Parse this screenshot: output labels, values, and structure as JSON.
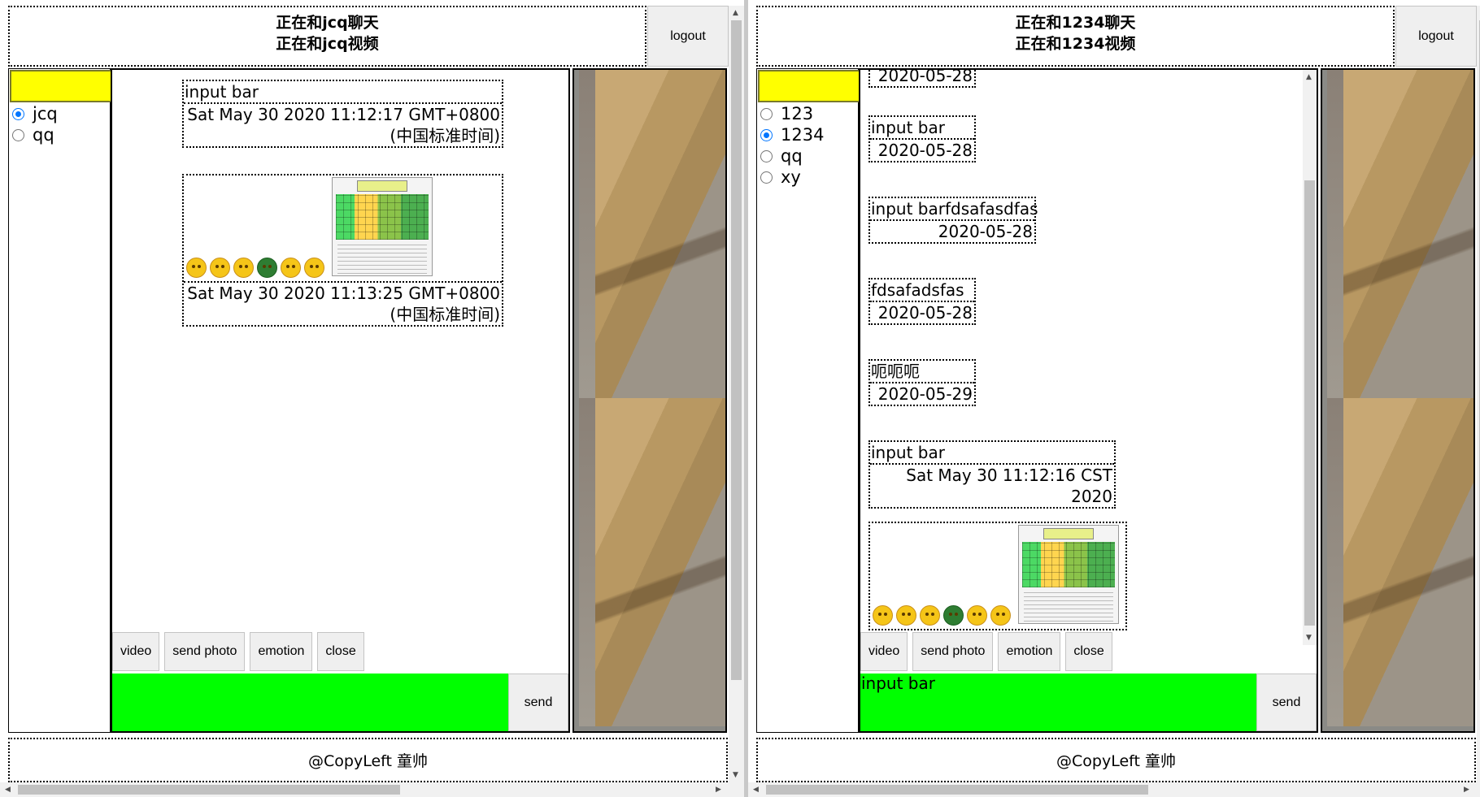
{
  "left": {
    "header": {
      "line1": "正在和jcq聊天",
      "line2": "正在和jcq视频"
    },
    "logout_label": "logout",
    "contacts": [
      {
        "label": "jcq",
        "checked": true
      },
      {
        "label": "qq",
        "checked": false
      }
    ],
    "messages": [
      {
        "text": "input bar",
        "time": "Sat May 30 2020 11:12:17 GMT+0800 (中国标准时间)"
      },
      {
        "text": "",
        "time": "Sat May 30 2020 11:13:25 GMT+0800 (中国标准时间)",
        "media": true
      }
    ],
    "toolbar": {
      "video": "video",
      "send_photo": "send photo",
      "emotion": "emotion",
      "close": "close"
    },
    "input_value": "",
    "send_label": "send",
    "footer": "@CopyLeft 童帅"
  },
  "right": {
    "header": {
      "line1": "正在和1234聊天",
      "line2": "正在和1234视频"
    },
    "logout_label": "logout",
    "contacts": [
      {
        "label": "123",
        "checked": false
      },
      {
        "label": "1234",
        "checked": true
      },
      {
        "label": "qq",
        "checked": false
      },
      {
        "label": "xy",
        "checked": false
      }
    ],
    "messages": [
      {
        "text": "",
        "time": "2020-05-28"
      },
      {
        "text": "input bar",
        "time": "2020-05-28"
      },
      {
        "text": "input barfdsafasdfas",
        "time": "2020-05-28"
      },
      {
        "text": "fdsafadsfas",
        "time": "2020-05-28"
      },
      {
        "text": "呃呃呃",
        "time": "2020-05-29"
      },
      {
        "text": "input bar",
        "time": "Sat May 30 11:12:16 CST 2020"
      },
      {
        "text": "",
        "time": "",
        "media": true
      }
    ],
    "toolbar": {
      "video": "video",
      "send_photo": "send photo",
      "emotion": "emotion",
      "close": "close"
    },
    "input_value": "input bar",
    "send_label": "send",
    "footer": "@CopyLeft 童帅"
  },
  "colors": {
    "contact_header": "#ffff00",
    "input_bg": "#00ff00"
  },
  "icons": {
    "emoji_set": [
      "smile-emoji-icon",
      "squint-emoji-icon",
      "grin-emoji-icon",
      "turtle-emoji-icon",
      "grimace-emoji-icon",
      "dizzy-emoji-icon"
    ]
  }
}
